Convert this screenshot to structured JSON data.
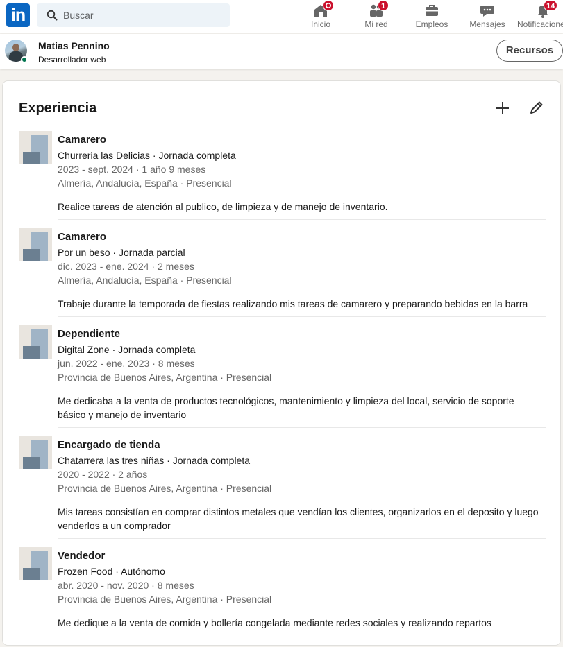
{
  "brand": {
    "logo_text": "in",
    "color": "#0a66c2"
  },
  "search": {
    "placeholder": "Buscar"
  },
  "nav": [
    {
      "label": "Inicio",
      "icon": "home-icon",
      "badge": ""
    },
    {
      "label": "Mi red",
      "icon": "network-icon",
      "badge": "1"
    },
    {
      "label": "Empleos",
      "icon": "briefcase-icon",
      "badge": ""
    },
    {
      "label": "Mensajes",
      "icon": "messaging-icon",
      "badge": ""
    },
    {
      "label": "Notificaciones",
      "icon": "bell-icon",
      "badge": "14"
    }
  ],
  "profile": {
    "name": "Matias Pennino",
    "headline": "Desarrollador web",
    "resources_label": "Recursos"
  },
  "experience": {
    "title": "Experiencia",
    "items": [
      {
        "role": "Camarero",
        "company": "Churreria las Delicias · Jornada completa",
        "dates": "2023 - sept. 2024 · 1 año 9 meses",
        "location": "Almería, Andalucía, España · Presencial",
        "description": "Realice tareas de atención al publico, de limpieza y de manejo de inventario."
      },
      {
        "role": "Camarero",
        "company": "Por un beso · Jornada parcial",
        "dates": "dic. 2023 - ene. 2024 · 2 meses",
        "location": "Almería, Andalucía, España · Presencial",
        "description": "Trabaje durante la temporada de fiestas realizando mis tareas de camarero y preparando bebidas en la barra"
      },
      {
        "role": "Dependiente",
        "company": "Digital Zone · Jornada completa",
        "dates": "jun. 2022 - ene. 2023 · 8 meses",
        "location": "Provincia de Buenos Aires, Argentina · Presencial",
        "description": "Me dedicaba a la venta de productos tecnológicos, mantenimiento y limpieza del local, servicio de soporte básico y manejo de inventario"
      },
      {
        "role": "Encargado de tienda",
        "company": "Chatarrera las tres niñas · Jornada completa",
        "dates": "2020 - 2022 · 2 años",
        "location": "Provincia de Buenos Aires, Argentina · Presencial",
        "description": "Mis tareas consistían en comprar distintos metales que vendían los clientes, organizarlos en el deposito y luego venderlos a un comprador"
      },
      {
        "role": "Vendedor",
        "company": "Frozen Food · Autónomo",
        "dates": "abr. 2020 - nov. 2020 · 8 meses",
        "location": "Provincia de Buenos Aires, Argentina · Presencial",
        "description": "Me dedique a la venta de comida y bollería congelada mediante redes sociales y realizando repartos"
      }
    ]
  }
}
